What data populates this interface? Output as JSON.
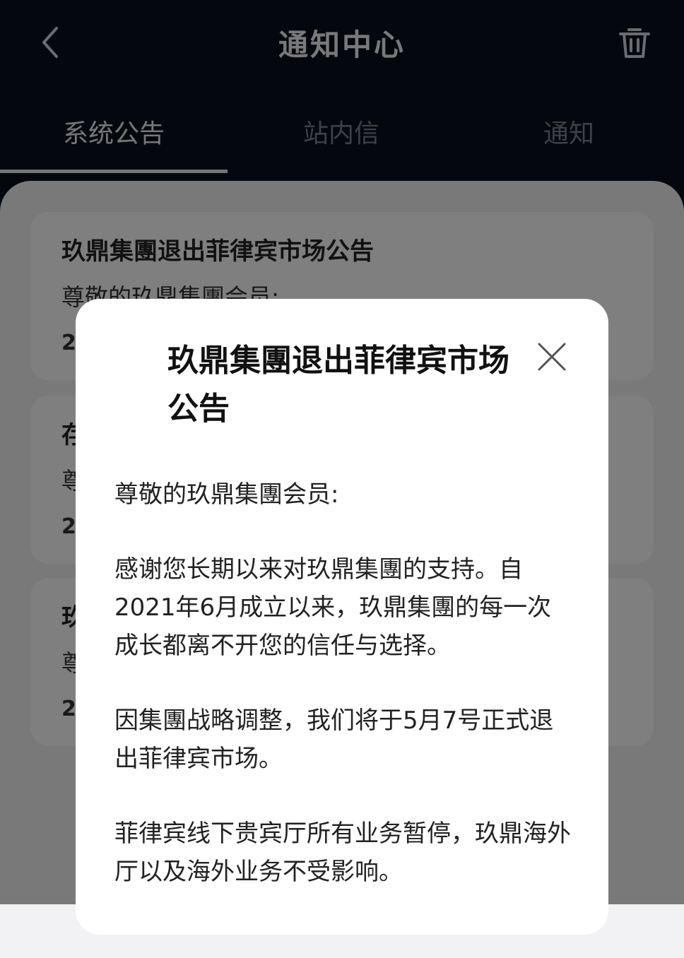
{
  "header": {
    "title": "通知中心",
    "back_icon": "chevron-left-icon",
    "delete_icon": "trash-icon"
  },
  "tabs": [
    {
      "label": "系统公告",
      "active": true
    },
    {
      "label": "站内信",
      "active": false
    },
    {
      "label": "通知",
      "active": false
    }
  ],
  "list": [
    {
      "title": "玖鼎集團退出菲律宾市场公告",
      "preview": "尊敬的玖鼎集團会员:",
      "date": "2"
    },
    {
      "title": "存",
      "preview": "尊",
      "date": "2"
    },
    {
      "title": "玖",
      "preview": "尊",
      "date": "2"
    }
  ],
  "modal": {
    "title": "玖鼎集團退出菲律宾市场公告",
    "close_icon": "close-icon",
    "paragraphs": [
      "尊敬的玖鼎集團会员:",
      "感谢您长期以来对玖鼎集團的支持。自2021年6月成立以来，玖鼎集團的每一次成长都离不开您的信任与选择。",
      "因集團战略调整，我们将于5月7号正式退出菲律宾市场。",
      "菲律宾线下贵宾厅所有业务暂停，玖鼎海外厅以及海外业务不受影响。"
    ]
  }
}
